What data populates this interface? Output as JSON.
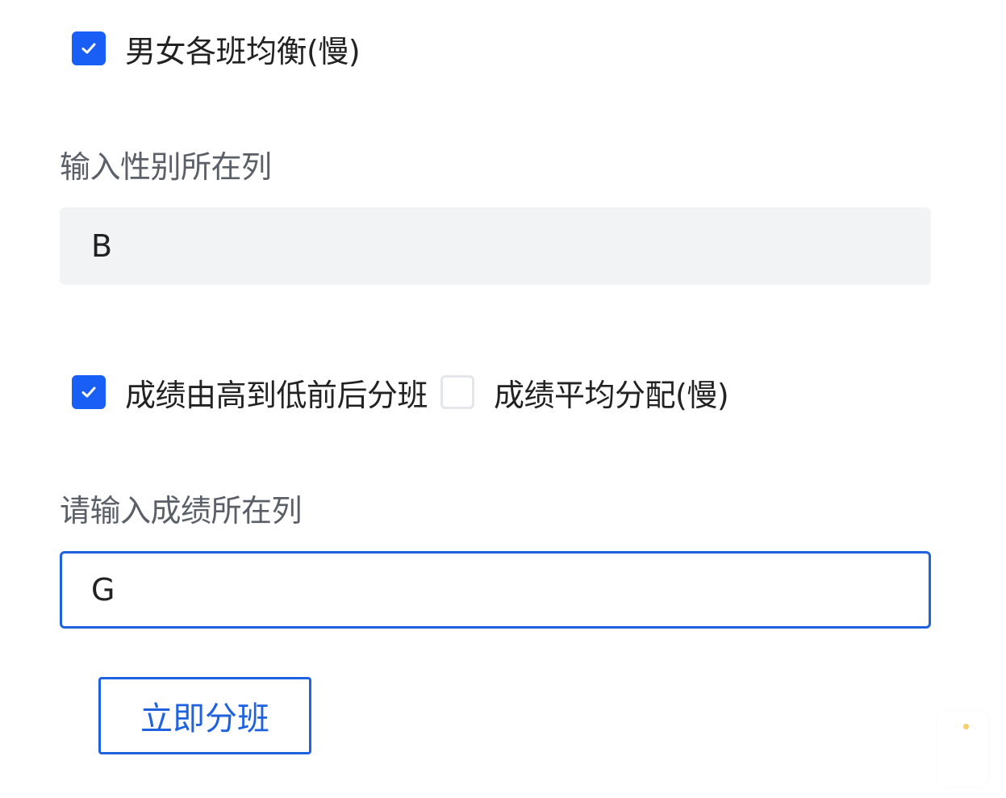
{
  "gender_balance": {
    "checked": true,
    "label": "男女各班均衡(慢)"
  },
  "gender_column": {
    "label": "输入性别所在列",
    "value": "B"
  },
  "score_options": [
    {
      "checked": true,
      "label": "成绩由高到低前后分班"
    },
    {
      "checked": false,
      "label": "成绩平均分配(慢)"
    }
  ],
  "score_column": {
    "label": "请输入成绩所在列",
    "value": "G"
  },
  "submit_button": {
    "label": "立即分班"
  },
  "colors": {
    "accent": "#1f62e0",
    "checkbox_fill": "#1a5ff5",
    "input_fill": "#f2f3f5"
  }
}
